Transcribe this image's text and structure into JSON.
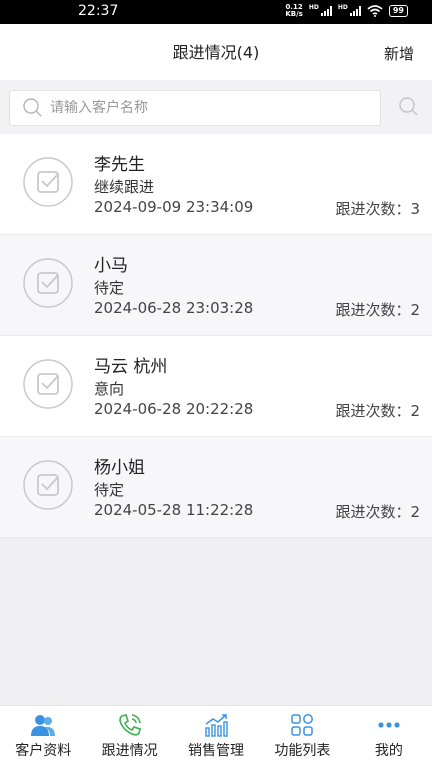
{
  "status_bar": {
    "time": "22:37",
    "net_speed": "0.12",
    "net_unit": "KB/s",
    "hd1": "HD",
    "hd2": "HD",
    "battery": "99"
  },
  "header": {
    "title": "跟进情况(4)",
    "add_label": "新增"
  },
  "search": {
    "placeholder": "请输入客户名称",
    "value": ""
  },
  "records": [
    {
      "name": "李先生",
      "status": "继续跟进",
      "datetime": "2024-09-09 23:34:09",
      "count_label": "跟进次数：3"
    },
    {
      "name": "小马",
      "status": "待定",
      "datetime": "2024-06-28 23:03:28",
      "count_label": "跟进次数：2"
    },
    {
      "name": "马云 杭州",
      "status": "意向",
      "datetime": "2024-06-28 20:22:28",
      "count_label": "跟进次数：2"
    },
    {
      "name": "杨小姐",
      "status": "待定",
      "datetime": "2024-05-28 11:22:28",
      "count_label": "跟进次数：2"
    }
  ],
  "tabbar": {
    "tabs": [
      {
        "label": "客户资料",
        "icon": "users-icon",
        "color": "#3a93e0"
      },
      {
        "label": "跟进情况",
        "icon": "phone-icon",
        "color": "#3cae4f"
      },
      {
        "label": "销售管理",
        "icon": "bar-chart-icon",
        "color": "#3a93e0"
      },
      {
        "label": "功能列表",
        "icon": "grid-icon",
        "color": "#3a93e0"
      },
      {
        "label": "我的",
        "icon": "more-icon",
        "color": "#3a93e0"
      }
    ]
  }
}
